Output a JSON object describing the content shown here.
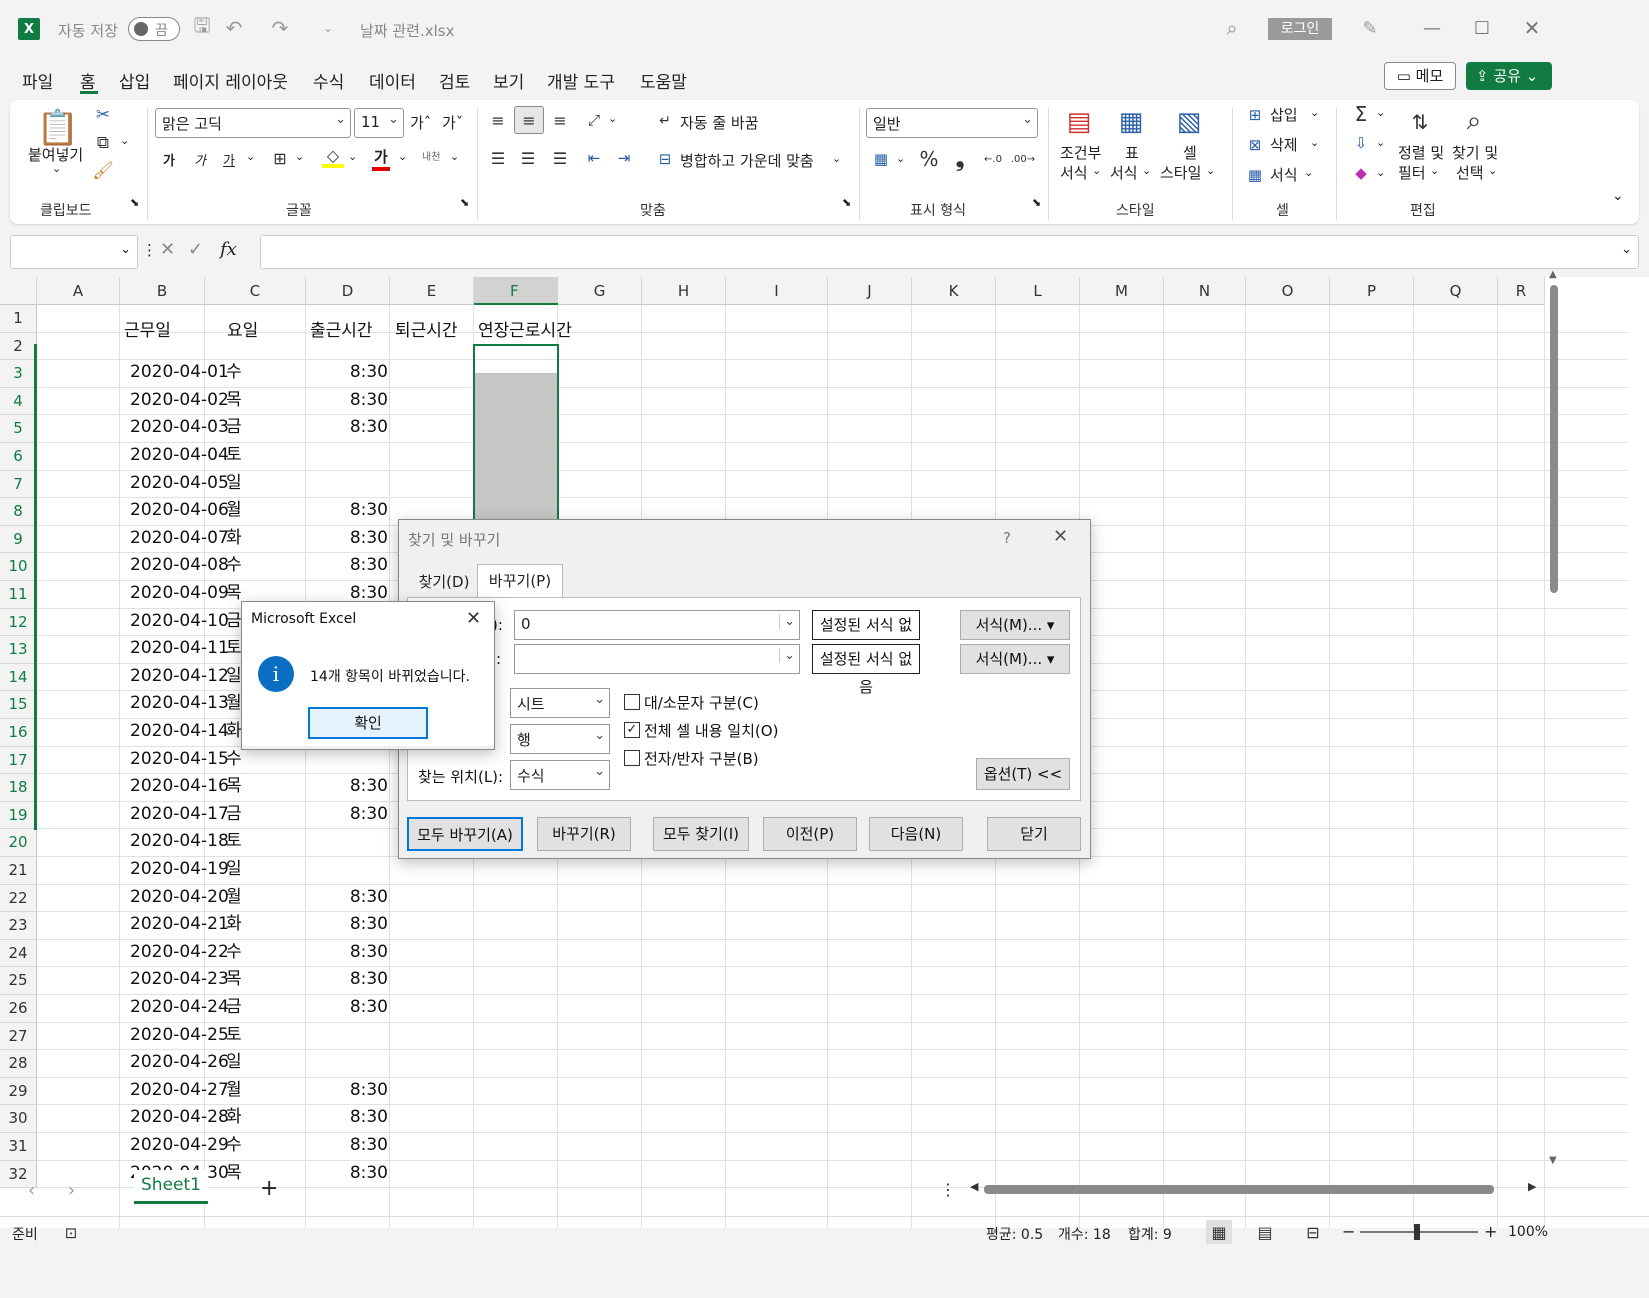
{
  "titlebar": {
    "autosave_label": "자동 저장",
    "autosave_state": "끔",
    "filename": "날짜 관련.xlsx",
    "login_label": "로그인"
  },
  "menu": {
    "tabs": [
      "파일",
      "홈",
      "삽입",
      "페이지 레이아웃",
      "수식",
      "데이터",
      "검토",
      "보기",
      "개발 도구",
      "도움말"
    ],
    "memo_label": "메모",
    "share_label": "공유",
    "active_tab": "홈"
  },
  "ribbon": {
    "clipboard": {
      "paste": "붙여넣기",
      "group": "클립보드"
    },
    "font": {
      "name": "맑은 고딕",
      "size": "11",
      "group": "글꼴",
      "bold": "가",
      "italic": "가",
      "underline": "가",
      "font_color_glyph": "가",
      "phonetic": "내천"
    },
    "align": {
      "wrap": "자동 줄 바꿈",
      "merge": "병합하고 가운데 맞춤",
      "group": "맞춤"
    },
    "number": {
      "format": "일반",
      "group": "표시 형식"
    },
    "styles": {
      "cond1": "조건부",
      "cond2": "서식",
      "table1": "표",
      "table2": "서식",
      "cell1": "셀",
      "cell2": "스타일",
      "group": "스타일"
    },
    "cells": {
      "insert": "삽입",
      "delete": "삭제",
      "format": "서식",
      "group": "셀"
    },
    "editing": {
      "sort1": "정렬 및",
      "sort2": "필터",
      "find1": "찾기 및",
      "find2": "선택",
      "group": "편집"
    }
  },
  "formula": {
    "fx": "fx"
  },
  "columns": [
    "A",
    "B",
    "C",
    "D",
    "E",
    "F",
    "G",
    "H",
    "I",
    "J",
    "K",
    "L",
    "M",
    "N",
    "O",
    "P",
    "Q",
    "R"
  ],
  "headers": {
    "b": "근무일",
    "c": "요일",
    "d": "출근시간",
    "e": "퇴근시간",
    "f": "연장근로시간"
  },
  "rows": [
    {
      "date": "2020-04-01",
      "day": "수",
      "in": "8:30"
    },
    {
      "date": "2020-04-02",
      "day": "목",
      "in": "8:30"
    },
    {
      "date": "2020-04-03",
      "day": "금",
      "in": "8:30"
    },
    {
      "date": "2020-04-04",
      "day": "토",
      "in": ""
    },
    {
      "date": "2020-04-05",
      "day": "일",
      "in": ""
    },
    {
      "date": "2020-04-06",
      "day": "월",
      "in": "8:30"
    },
    {
      "date": "2020-04-07",
      "day": "화",
      "in": "8:30"
    },
    {
      "date": "2020-04-08",
      "day": "수",
      "in": "8:30"
    },
    {
      "date": "2020-04-09",
      "day": "목",
      "in": "8:30"
    },
    {
      "date": "2020-04-10",
      "day": "금",
      "in": ""
    },
    {
      "date": "2020-04-11",
      "day": "토",
      "in": ""
    },
    {
      "date": "2020-04-12",
      "day": "일",
      "in": ""
    },
    {
      "date": "2020-04-13",
      "day": "월",
      "in": ""
    },
    {
      "date": "2020-04-14",
      "day": "화",
      "in": ""
    },
    {
      "date": "2020-04-15",
      "day": "수",
      "in": ""
    },
    {
      "date": "2020-04-16",
      "day": "목",
      "in": "8:30"
    },
    {
      "date": "2020-04-17",
      "day": "금",
      "in": "8:30"
    },
    {
      "date": "2020-04-18",
      "day": "토",
      "in": ""
    },
    {
      "date": "2020-04-19",
      "day": "일",
      "in": ""
    },
    {
      "date": "2020-04-20",
      "day": "월",
      "in": "8:30"
    },
    {
      "date": "2020-04-21",
      "day": "화",
      "in": "8:30"
    },
    {
      "date": "2020-04-22",
      "day": "수",
      "in": "8:30"
    },
    {
      "date": "2020-04-23",
      "day": "목",
      "in": "8:30"
    },
    {
      "date": "2020-04-24",
      "day": "금",
      "in": "8:30"
    },
    {
      "date": "2020-04-25",
      "day": "토",
      "in": ""
    },
    {
      "date": "2020-04-26",
      "day": "일",
      "in": ""
    },
    {
      "date": "2020-04-27",
      "day": "월",
      "in": "8:30"
    },
    {
      "date": "2020-04-28",
      "day": "화",
      "in": "8:30"
    },
    {
      "date": "2020-04-29",
      "day": "수",
      "in": "8:30"
    },
    {
      "date": "2020-04-30",
      "day": "목",
      "in": "8:30"
    }
  ],
  "row_numbers": [
    "1",
    "2",
    "3",
    "4",
    "5",
    "6",
    "7",
    "8",
    "9",
    "10",
    "11",
    "12",
    "13",
    "14",
    "15",
    "16",
    "17",
    "18",
    "19",
    "20",
    "21",
    "22",
    "23",
    "24",
    "25",
    "26",
    "27",
    "28",
    "29",
    "30",
    "31",
    "32"
  ],
  "sheet_tab": "Sheet1",
  "status": {
    "ready": "준비",
    "avg": "평균: 0.5",
    "count": "개수: 18",
    "sum": "합계: 9",
    "zoom": "100%"
  },
  "find_dialog": {
    "title": "찾기 및 바꾸기",
    "help": "?",
    "tab_find": "찾기(D)",
    "tab_replace": "바꾸기(P)",
    "find_value": "0",
    "find_suffix": "):",
    "replace_suffix": ":",
    "no_format": "설정된 서식 없음",
    "format_btn": "서식(M)...",
    "within_value": "시트",
    "search_value": "행",
    "lookin_label": "찾는 위치(L):",
    "lookin_value": "수식",
    "match_case": "대/소문자 구분(C)",
    "match_entire": "전체 셀 내용 일치(O)",
    "match_width": "전자/반자 구분(B)",
    "options_btn": "옵션(T) <<",
    "replace_all": "모두 바꾸기(A)",
    "replace": "바꾸기(R)",
    "find_all": "모두 찾기(I)",
    "prev": "이전(P)",
    "next": "다음(N)",
    "close": "닫기"
  },
  "msgbox": {
    "title": "Microsoft Excel",
    "message": "14개 항목이 바뀌었습니다.",
    "ok": "확인"
  }
}
